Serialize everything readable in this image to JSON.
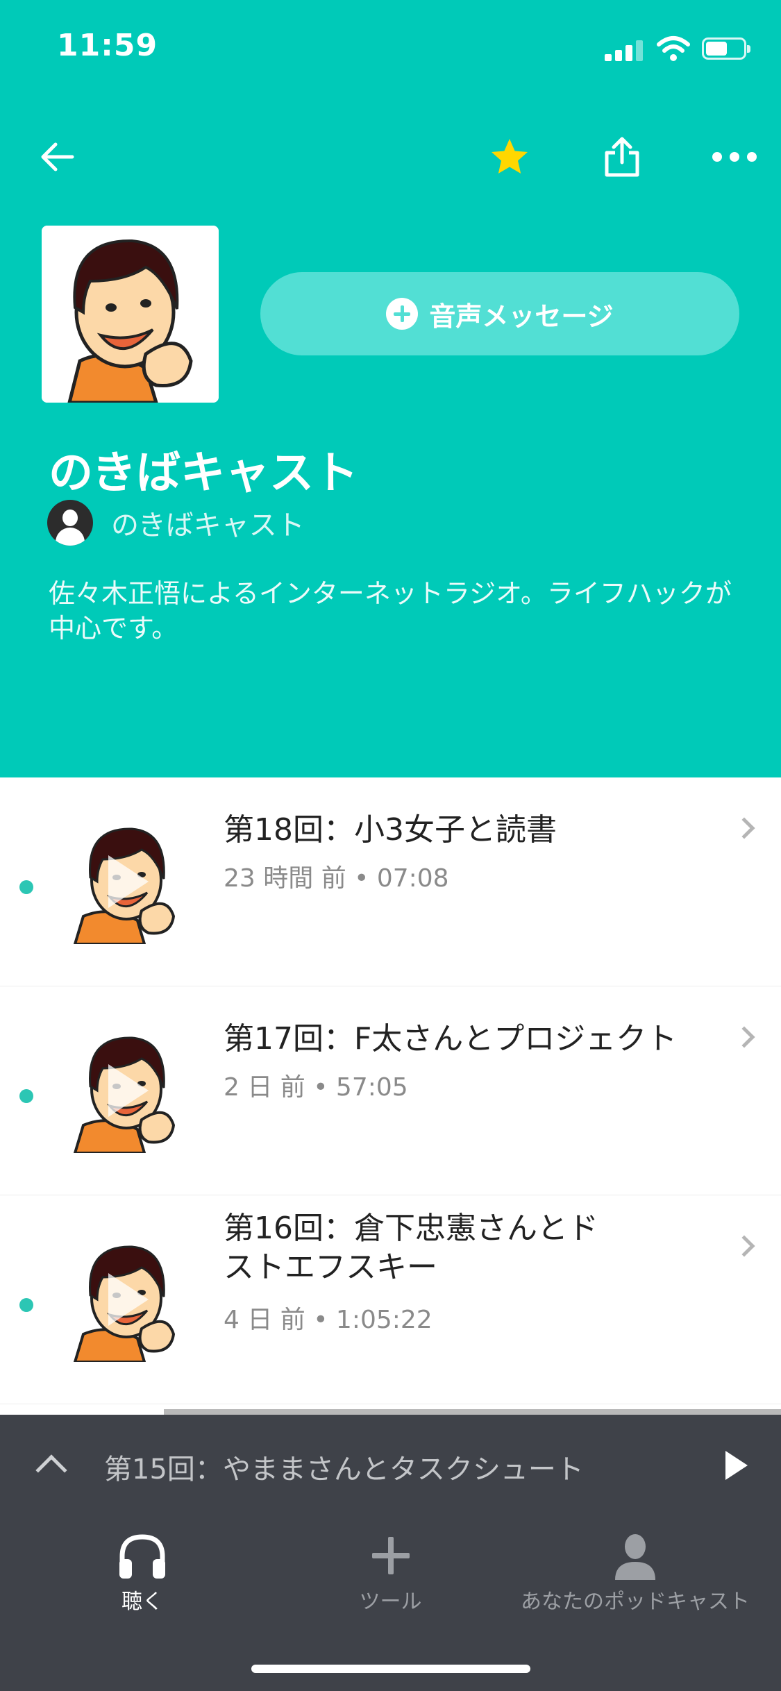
{
  "status_bar": {
    "time": "11:59"
  },
  "header": {
    "voice_message_label": "音声メッセージ",
    "show_title": "のきばキャスト",
    "author_name": "のきばキャスト",
    "description": "佐々木正悟によるインターネットラジオ。ライフハックが中心です。",
    "icons": {
      "back": "back-arrow-icon",
      "favorite": "star-icon",
      "share": "share-icon",
      "more": "more-icon"
    },
    "colors": {
      "background": "#00cab8",
      "star": "#ffd700"
    }
  },
  "episodes": [
    {
      "title": "第18回：小3女子と読書",
      "time_ago": "23 時間 前",
      "duration": "07:08",
      "unplayed": true
    },
    {
      "title": "第17回：F太さんとプロジェクト",
      "time_ago": "2 日 前",
      "duration": "57:05",
      "unplayed": true
    },
    {
      "title": "第16回：倉下忠憲さんとドストエフスキー",
      "time_ago": "4 日 前",
      "duration": "1:05:22",
      "unplayed": true
    }
  ],
  "player": {
    "now_playing": "第15回：やままさんとタスクシュート",
    "progress": 0.21
  },
  "tabbar": {
    "tabs": [
      {
        "label": "聴く",
        "icon": "headphones-icon",
        "active": true
      },
      {
        "label": "ツール",
        "icon": "plus-icon",
        "active": false
      },
      {
        "label": "あなたのポッドキャスト",
        "icon": "person-icon",
        "active": false
      }
    ]
  }
}
